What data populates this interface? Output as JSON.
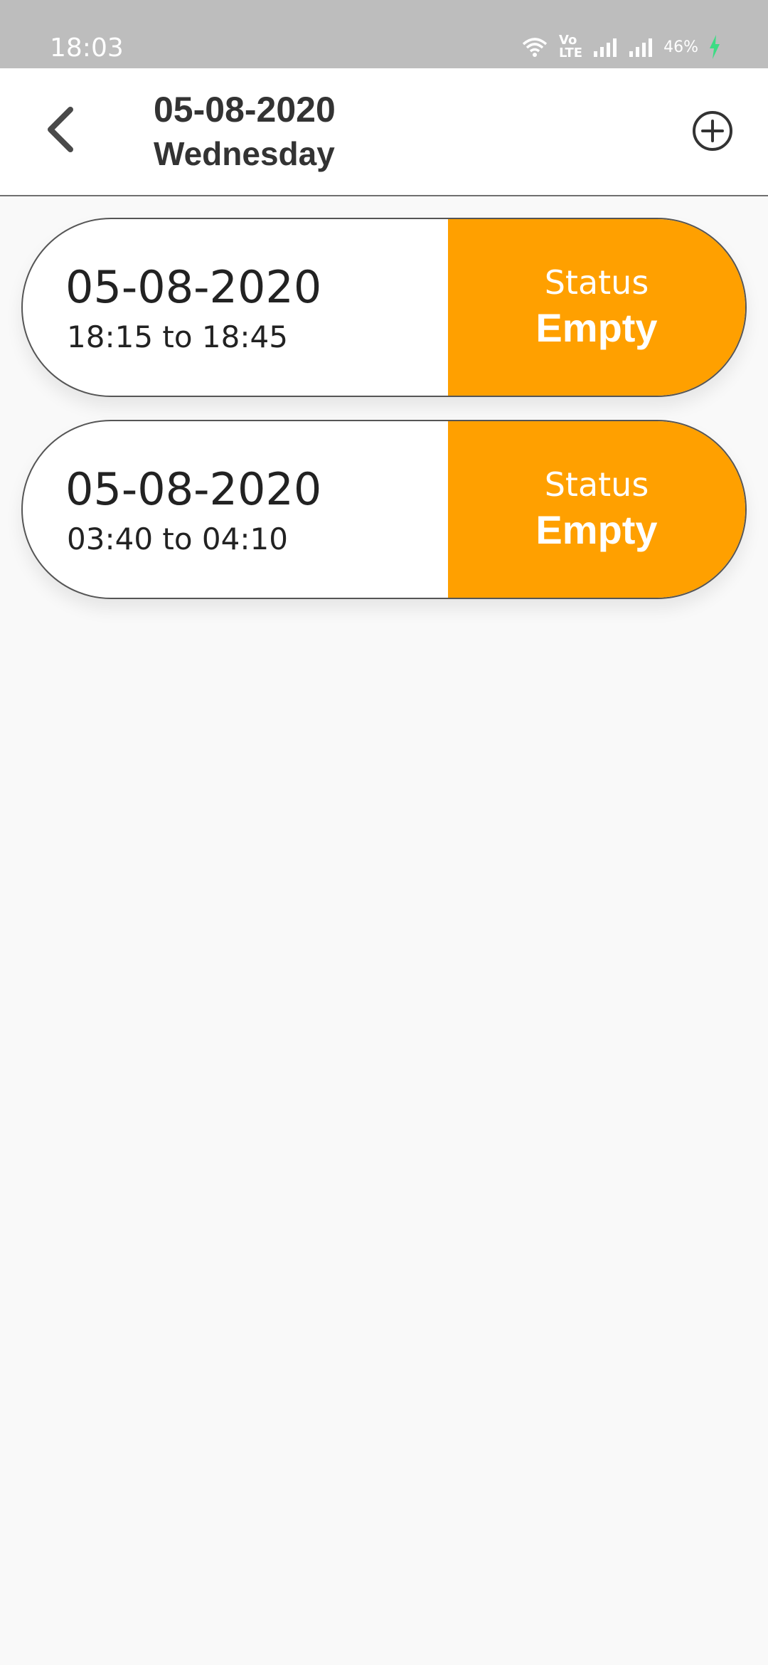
{
  "status_bar": {
    "time": "18:03",
    "volte_top": "Vo",
    "volte_bottom": "LTE",
    "battery": "46%",
    "icons": [
      "wifi-icon",
      "volte-icon",
      "signal-icon",
      "signal-icon",
      "battery-charging-icon"
    ]
  },
  "header": {
    "back_icon": "chevron-left-icon",
    "date": "05-08-2020",
    "day": "Wednesday",
    "add_icon": "plus-circle-icon"
  },
  "slots": [
    {
      "date": "05-08-2020",
      "time": "18:15 to 18:45",
      "status_label": "Status",
      "status_value": "Empty"
    },
    {
      "date": "05-08-2020",
      "time": "03:40 to 04:10",
      "status_label": "Status",
      "status_value": "Empty"
    }
  ],
  "colors": {
    "status_bar_bg": "#bdbdbd",
    "accent_orange": "#ffa000",
    "page_bg": "#f9f9f9",
    "text_dark": "#333333"
  }
}
